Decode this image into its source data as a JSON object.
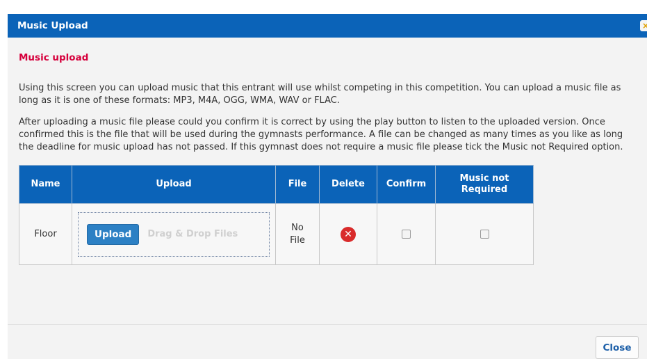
{
  "dialog": {
    "title": "Music Upload",
    "close_icon_glyph": "×"
  },
  "content": {
    "subheading": "Music upload",
    "paragraph1": "Using this screen you can upload music that this entrant will use whilst competing in this competition. You can upload a music file as long as it is one of these formats: MP3, M4A, OGG, WMA, WAV or FLAC.",
    "paragraph2": "After uploading a music file please could you confirm it is correct by using the play button to listen to the uploaded version. Once confirmed this is the file that will be used during the gymnasts performance. A file can be changed as many times as you like as long the deadline for music upload has not passed. If this gymnast does not require a music file please tick the Music not Required option."
  },
  "table": {
    "headers": {
      "name": "Name",
      "upload": "Upload",
      "file": "File",
      "delete": "Delete",
      "confirm": "Confirm",
      "not_required": "Music not Required"
    },
    "rows": [
      {
        "name": "Floor",
        "upload_button": "Upload",
        "drag_text": "Drag & Drop Files",
        "file": "No File",
        "delete_icon": "delete-icon",
        "confirm_checked": false,
        "not_required_checked": false
      }
    ]
  },
  "footer": {
    "close_label": "Close"
  },
  "colors": {
    "header_blue": "#0b63b8",
    "subheading_red": "#d6003c",
    "delete_red": "#d92b2b"
  }
}
